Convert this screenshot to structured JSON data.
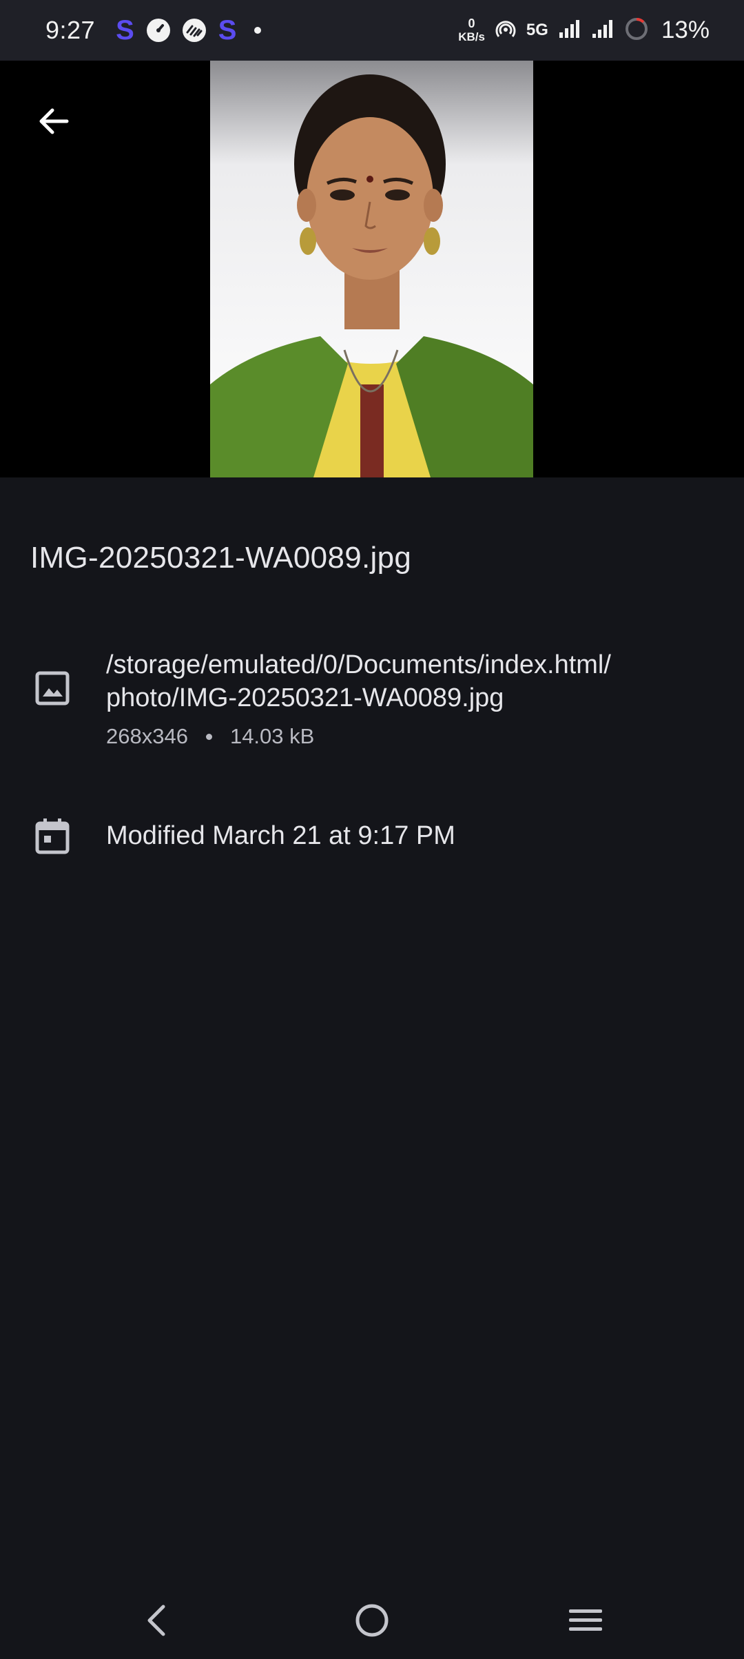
{
  "status_bar": {
    "time": "9:27",
    "app_icons": [
      "s-app-icon",
      "speedometer-icon",
      "handshake-icon",
      "s-app-icon"
    ],
    "app_s_letter": "S",
    "net_speed_value": "0",
    "net_speed_unit": "KB/s",
    "network_type": "5G",
    "battery": "13%",
    "accent_color": "#5b4cf0"
  },
  "toolbar": {
    "back_icon": "arrow-left-icon"
  },
  "file": {
    "name": "IMG-20250321-WA0089.jpg",
    "path_line1": "/storage/emulated/0/Documents/index.html/",
    "path_line2": "photo/IMG-20250321-WA0089.jpg",
    "dimensions": "268x346",
    "size": "14.03 kB",
    "modified": "Modified March 21 at 9:17 PM",
    "image_icon": "image-icon",
    "calendar_icon": "calendar-icon"
  },
  "nav_bar": {
    "icons": [
      "back-chevron-icon",
      "home-circle-icon",
      "recents-menu-icon"
    ]
  }
}
